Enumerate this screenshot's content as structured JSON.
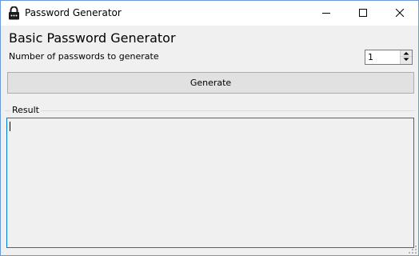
{
  "window": {
    "title": "Password Generator",
    "icon": "lock-icon",
    "controls": [
      "minimize-icon",
      "maximize-icon",
      "close-icon"
    ]
  },
  "main": {
    "heading": "Basic Password Generator",
    "count_label": "Number of passwords to generate",
    "count_value": "1",
    "generate_label": "Generate"
  },
  "result": {
    "group_label": "Result",
    "text": ""
  },
  "colors": {
    "focus_border": "#0078d7",
    "window_bg": "#f0f0f0",
    "titlebar_bg": "#ffffff"
  }
}
